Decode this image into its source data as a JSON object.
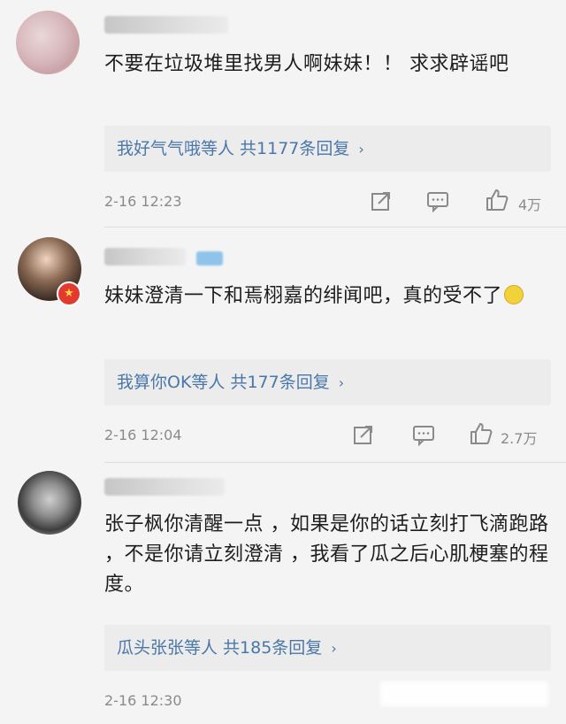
{
  "comments": [
    {
      "text": "不要在垃圾堆里找男人啊妹妹！！ 求求辟谣吧",
      "reply_summary": "我好气气哦等人 共1177条回复",
      "time": "2-16 12:23",
      "likes": "4万"
    },
    {
      "text": "妹妹澄清一下和焉栩嘉的绯闻吧，真的受不了",
      "reply_summary": "我算你OK等人 共177条回复",
      "time": "2-16 12:04",
      "likes": "2.7万"
    },
    {
      "text": "张子枫你清醒一点 ，如果是你的话立刻打飞滴跑路 ，不是你请立刻澄清 ，我看了瓜之后心肌梗塞的程度。",
      "reply_summary": "瓜头张张等人 共185条回复",
      "time": "2-16 12:30"
    }
  ],
  "icons": {
    "chevron": "›",
    "share": "share-icon",
    "comment": "comment-icon",
    "like": "thumbs-up-icon"
  },
  "colors": {
    "background": "#f4f4f4",
    "link": "#4a77aa",
    "meta": "#8a8a8a",
    "reply_box": "#ececec"
  }
}
